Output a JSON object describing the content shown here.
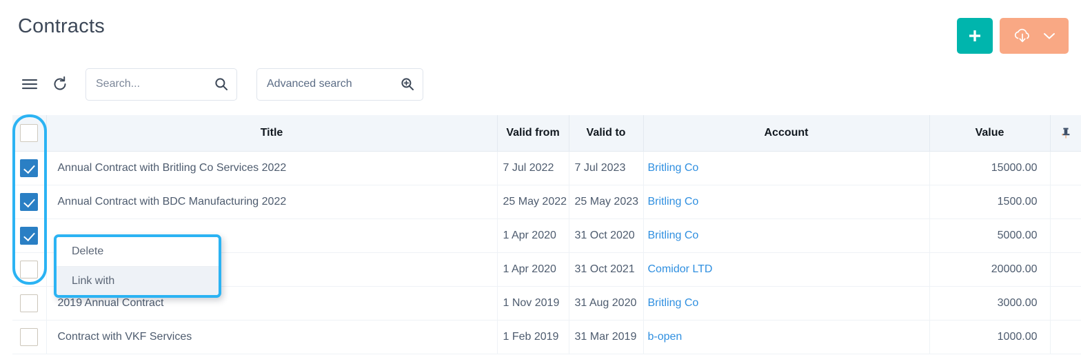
{
  "header": {
    "title": "Contracts",
    "add_button_label": "+",
    "add_icon": "plus-icon",
    "export_icon": "cloud-download-icon",
    "export_caret_icon": "chevron-down-icon",
    "accent_teal": "#00b5ad",
    "accent_salmon": "#f9a884"
  },
  "toolbar": {
    "menu_icon": "hamburger-menu-icon",
    "refresh_icon": "refresh-icon",
    "search": {
      "value": "",
      "placeholder": "Search...",
      "icon": "search-icon"
    },
    "advanced_search": {
      "value": "Advanced search",
      "placeholder": "Advanced search",
      "icon": "search-plus-icon"
    }
  },
  "table": {
    "select_all_checked": false,
    "columns": [
      {
        "key": "check",
        "label": ""
      },
      {
        "key": "title",
        "label": "Title"
      },
      {
        "key": "from",
        "label": "Valid from"
      },
      {
        "key": "to",
        "label": "Valid to"
      },
      {
        "key": "account",
        "label": "Account"
      },
      {
        "key": "value",
        "label": "Value"
      },
      {
        "key": "pin",
        "label": ""
      }
    ],
    "pin_icon": "pushpin-icon",
    "rows": [
      {
        "checked": true,
        "title": "Annual Contract with Britling Co Services 2022",
        "valid_from": "7 Jul 2022",
        "valid_to": "7 Jul 2023",
        "account": "Britling Co",
        "value": "15000.00"
      },
      {
        "checked": true,
        "title": "Annual Contract with BDC Manufacturing 2022",
        "valid_from": "25 May 2022",
        "valid_to": "25 May 2023",
        "account": "Britling Co",
        "value": "1500.00"
      },
      {
        "checked": true,
        "title": "",
        "valid_from": "1 Apr 2020",
        "valid_to": "31 Oct 2020",
        "account": "Britling Co",
        "value": "5000.00"
      },
      {
        "checked": false,
        "title": "",
        "valid_from": "1 Apr 2020",
        "valid_to": "31 Oct 2021",
        "account": "Comidor LTD",
        "value": "20000.00"
      },
      {
        "checked": false,
        "title": "2019 Annual Contract",
        "valid_from": "1 Nov 2019",
        "valid_to": "31 Aug 2020",
        "account": "Britling Co",
        "value": "3000.00"
      },
      {
        "checked": false,
        "title": "Contract with VKF Services",
        "valid_from": "1 Feb 2019",
        "valid_to": "31 Mar 2019",
        "account": "b-open",
        "value": "1000.00"
      }
    ]
  },
  "context_menu": {
    "items": [
      {
        "label": "Delete",
        "hovered": false
      },
      {
        "label": "Link with",
        "hovered": true
      }
    ],
    "highlight_color": "#2bb3f3"
  }
}
